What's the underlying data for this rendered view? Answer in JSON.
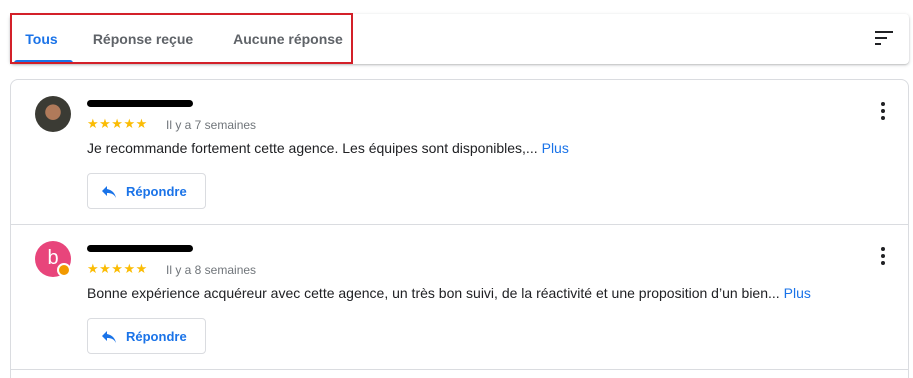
{
  "tabs": [
    {
      "label": "Tous",
      "active": true
    },
    {
      "label": "Réponse reçue",
      "active": false
    },
    {
      "label": "Aucune réponse",
      "active": false
    }
  ],
  "toolbar": {
    "sort_icon": "sort-icon"
  },
  "colors": {
    "accent": "#1a73e8",
    "star": "#fbbc04",
    "highlight": "#d32029",
    "avatar_2": "#e8457b"
  },
  "reviews": [
    {
      "avatar_type": "photo",
      "stars": "★★★★★",
      "rating": 5,
      "date": "Il y a 7 semaines",
      "text": "Je recommande fortement cette agence. Les équipes sont disponibles,...",
      "more_label": "Plus",
      "reply_label": "Répondre"
    },
    {
      "avatar_type": "letter",
      "avatar_letter": "b",
      "stars": "★★★★★",
      "rating": 5,
      "date": "Il y a 8 semaines",
      "text": "Bonne expérience acquéreur avec cette agence, un très bon suivi, de la réactivité et une proposition d’un bien...",
      "more_label": "Plus",
      "reply_label": "Répondre"
    }
  ]
}
